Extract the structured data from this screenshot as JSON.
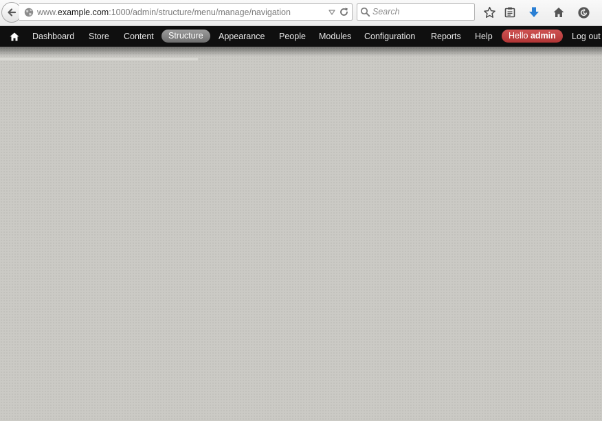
{
  "browser": {
    "url": {
      "prefix": "www.",
      "host": "example.com",
      "rest": ":1000/admin/structure/menu/manage/navigation"
    },
    "search": {
      "placeholder": "Search"
    },
    "toolbar_icons": [
      "star-icon",
      "clipboard-icon",
      "download-arrow-icon",
      "home-icon",
      "history-icon"
    ]
  },
  "admin_toolbar": {
    "items": [
      {
        "label": "Dashboard"
      },
      {
        "label": "Store"
      },
      {
        "label": "Content"
      },
      {
        "label": "Structure",
        "active": true
      },
      {
        "label": "Appearance"
      },
      {
        "label": "People"
      },
      {
        "label": "Modules"
      },
      {
        "label": "Configuration"
      },
      {
        "label": "Reports"
      },
      {
        "label": "Help"
      }
    ],
    "greeting": "Hello",
    "username": "admin",
    "logout": "Log out"
  },
  "colors": {
    "toolbar_bg": "#0f0f0f",
    "active_pill": "#8a8a8a",
    "user_badge": "#c04444",
    "page_bg": "#cbcac5",
    "download_arrow": "#2a7fd4"
  }
}
